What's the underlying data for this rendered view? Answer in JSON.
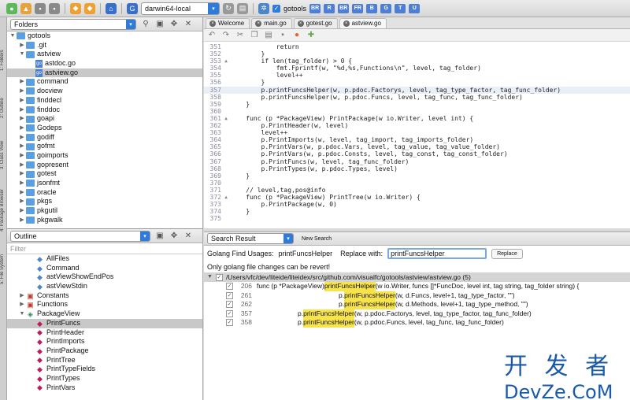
{
  "toolbar": {
    "env": "darwin64-local",
    "project_check_label": "gotools",
    "chips": [
      "BR",
      "R",
      "BR",
      "FR",
      "B",
      "G",
      "T",
      "U"
    ]
  },
  "side_tabs": [
    "1: Folders",
    "2: Outline",
    "3: Class View",
    "4: Package Browser",
    "5: File System"
  ],
  "folders_panel": {
    "title": "Folders",
    "items": [
      {
        "depth": 0,
        "expand": "▼",
        "kind": "folder",
        "label": "gotools",
        "sel": false
      },
      {
        "depth": 1,
        "expand": "▶",
        "kind": "folder",
        "label": ".git",
        "sel": false
      },
      {
        "depth": 1,
        "expand": "▼",
        "kind": "folder",
        "label": "astview",
        "sel": false
      },
      {
        "depth": 2,
        "expand": "",
        "kind": "file",
        "label": "astdoc.go",
        "sel": false
      },
      {
        "depth": 2,
        "expand": "",
        "kind": "file",
        "label": "astview.go",
        "sel": true
      },
      {
        "depth": 1,
        "expand": "▶",
        "kind": "folder",
        "label": "command",
        "sel": false
      },
      {
        "depth": 1,
        "expand": "▶",
        "kind": "folder",
        "label": "docview",
        "sel": false
      },
      {
        "depth": 1,
        "expand": "▶",
        "kind": "folder",
        "label": "finddecl",
        "sel": false
      },
      {
        "depth": 1,
        "expand": "▶",
        "kind": "folder",
        "label": "finddoc",
        "sel": false
      },
      {
        "depth": 1,
        "expand": "▶",
        "kind": "folder",
        "label": "goapi",
        "sel": false
      },
      {
        "depth": 1,
        "expand": "▶",
        "kind": "folder",
        "label": "Godeps",
        "sel": false
      },
      {
        "depth": 1,
        "expand": "▶",
        "kind": "folder",
        "label": "godiff",
        "sel": false
      },
      {
        "depth": 1,
        "expand": "▶",
        "kind": "folder",
        "label": "gofmt",
        "sel": false
      },
      {
        "depth": 1,
        "expand": "▶",
        "kind": "folder",
        "label": "goimports",
        "sel": false
      },
      {
        "depth": 1,
        "expand": "▶",
        "kind": "folder",
        "label": "gopresent",
        "sel": false
      },
      {
        "depth": 1,
        "expand": "▶",
        "kind": "folder",
        "label": "gotest",
        "sel": false
      },
      {
        "depth": 1,
        "expand": "▶",
        "kind": "folder",
        "label": "jsonfmt",
        "sel": false
      },
      {
        "depth": 1,
        "expand": "▶",
        "kind": "folder",
        "label": "oracle",
        "sel": false
      },
      {
        "depth": 1,
        "expand": "▶",
        "kind": "folder",
        "label": "pkgs",
        "sel": false
      },
      {
        "depth": 1,
        "expand": "▶",
        "kind": "folder",
        "label": "pkgutil",
        "sel": false
      },
      {
        "depth": 1,
        "expand": "▶",
        "kind": "folder",
        "label": "pkgwalk",
        "sel": false
      }
    ]
  },
  "outline_panel": {
    "title": "Outline",
    "filter_placeholder": "Filter",
    "items": [
      {
        "depth": 2,
        "expand": "",
        "icon": "◆",
        "color": "#4a86c8",
        "label": "AllFiles",
        "sel": false
      },
      {
        "depth": 2,
        "expand": "",
        "icon": "◆",
        "color": "#4a86c8",
        "label": "Command",
        "sel": false
      },
      {
        "depth": 2,
        "expand": "",
        "icon": "◆",
        "color": "#4a86c8",
        "label": "astViewShowEndPos",
        "sel": false
      },
      {
        "depth": 2,
        "expand": "",
        "icon": "◆",
        "color": "#4a86c8",
        "label": "astViewStdin",
        "sel": false
      },
      {
        "depth": 1,
        "expand": "▶",
        "icon": "▣",
        "color": "#c0392b",
        "label": "Constants",
        "sel": false
      },
      {
        "depth": 1,
        "expand": "▶",
        "icon": "▣",
        "color": "#c0392b",
        "label": "Functions",
        "sel": false
      },
      {
        "depth": 1,
        "expand": "▼",
        "icon": "◈",
        "color": "#2e8b57",
        "label": "PackageView",
        "sel": false
      },
      {
        "depth": 2,
        "expand": "",
        "icon": "◆",
        "color": "#c2185b",
        "label": "PrintFuncs",
        "sel": true
      },
      {
        "depth": 2,
        "expand": "",
        "icon": "◆",
        "color": "#c2185b",
        "label": "PrintHeader",
        "sel": false
      },
      {
        "depth": 2,
        "expand": "",
        "icon": "◆",
        "color": "#c2185b",
        "label": "PrintImports",
        "sel": false
      },
      {
        "depth": 2,
        "expand": "",
        "icon": "◆",
        "color": "#c2185b",
        "label": "PrintPackage",
        "sel": false
      },
      {
        "depth": 2,
        "expand": "",
        "icon": "◆",
        "color": "#c2185b",
        "label": "PrintTree",
        "sel": false
      },
      {
        "depth": 2,
        "expand": "",
        "icon": "◆",
        "color": "#c2185b",
        "label": "PrintTypeFields",
        "sel": false
      },
      {
        "depth": 2,
        "expand": "",
        "icon": "◆",
        "color": "#c2185b",
        "label": "PrintTypes",
        "sel": false
      },
      {
        "depth": 2,
        "expand": "",
        "icon": "◆",
        "color": "#c2185b",
        "label": "PrintVars",
        "sel": false
      }
    ]
  },
  "editor": {
    "tabs": [
      {
        "label": "Welcome",
        "active": false
      },
      {
        "label": "main.go",
        "active": false
      },
      {
        "label": "gotest.go",
        "active": false
      },
      {
        "label": "astview.go",
        "active": true
      }
    ],
    "lines": [
      {
        "n": "351",
        "fold": "",
        "text": "            return",
        "cur": false
      },
      {
        "n": "352",
        "fold": "",
        "text": "        }",
        "cur": false
      },
      {
        "n": "353",
        "fold": "▲",
        "text": "        if len(tag_folder) > 0 {",
        "cur": false
      },
      {
        "n": "354",
        "fold": "",
        "text": "            fmt.Fprintf(w, \"%d,%s,Functions\\n\", level, tag_folder)",
        "cur": false
      },
      {
        "n": "355",
        "fold": "",
        "text": "            level++",
        "cur": false
      },
      {
        "n": "356",
        "fold": "",
        "text": "        }",
        "cur": false
      },
      {
        "n": "357",
        "fold": "",
        "text": "        p.printFuncsHelper(w, p.pdoc.Factorys, level, tag_type_factor, tag_func_folder)",
        "cur": true
      },
      {
        "n": "358",
        "fold": "",
        "text": "        p.printFuncsHelper(w, p.pdoc.Funcs, level, tag_func, tag_func_folder)",
        "cur": false
      },
      {
        "n": "359",
        "fold": "",
        "text": "    }",
        "cur": false
      },
      {
        "n": "360",
        "fold": "",
        "text": "",
        "cur": false
      },
      {
        "n": "361",
        "fold": "▲",
        "text": "    func (p *PackageView) PrintPackage(w io.Writer, level int) {",
        "cur": false
      },
      {
        "n": "362",
        "fold": "",
        "text": "        p.PrintHeader(w, level)",
        "cur": false
      },
      {
        "n": "363",
        "fold": "",
        "text": "        level++",
        "cur": false
      },
      {
        "n": "364",
        "fold": "",
        "text": "        p.PrintImports(w, level, tag_import, tag_imports_folder)",
        "cur": false
      },
      {
        "n": "365",
        "fold": "",
        "text": "        p.PrintVars(w, p.pdoc.Vars, level, tag_value, tag_value_folder)",
        "cur": false
      },
      {
        "n": "366",
        "fold": "",
        "text": "        p.PrintVars(w, p.pdoc.Consts, level, tag_const, tag_const_folder)",
        "cur": false
      },
      {
        "n": "367",
        "fold": "",
        "text": "        p.PrintFuncs(w, level, tag_func_folder)",
        "cur": false
      },
      {
        "n": "368",
        "fold": "",
        "text": "        p.PrintTypes(w, p.pdoc.Types, level)",
        "cur": false
      },
      {
        "n": "369",
        "fold": "",
        "text": "    }",
        "cur": false
      },
      {
        "n": "370",
        "fold": "",
        "text": "",
        "cur": false
      },
      {
        "n": "371",
        "fold": "",
        "text": "    // level,tag,pos@info",
        "cur": false
      },
      {
        "n": "372",
        "fold": "▲",
        "text": "    func (p *PackageView) PrintTree(w io.Writer) {",
        "cur": false
      },
      {
        "n": "373",
        "fold": "",
        "text": "        p.PrintPackage(w, 0)",
        "cur": false
      },
      {
        "n": "374",
        "fold": "",
        "text": "    }",
        "cur": false
      },
      {
        "n": "375",
        "fold": "",
        "text": "",
        "cur": false
      }
    ]
  },
  "search": {
    "title": "Search Result",
    "new_search": "New Search",
    "usage_label": "Golang Find Usages:",
    "usage_term": "printFuncsHelper",
    "replace_label": "Replace with:",
    "replace_value": "printFuncsHelper",
    "replace_button": "Replace",
    "warning": "Only golang file changes can be revert!",
    "file_path": "/Users/vfc/dev/liteide/liteidex/src/github.com/visualfc/gotools/astview/astview.go (5)",
    "results": [
      {
        "n": "206",
        "pre": "func (p *PackageView) ",
        "match": "printFuncsHelper",
        "post": "(w io.Writer, funcs []*FuncDoc, level int, tag string, tag_folder string) {",
        "indent": 0
      },
      {
        "n": "261",
        "pre": "p.",
        "match": "printFuncsHelper",
        "post": "(w, d.Funcs, level+1, tag_type_factor, \"\")",
        "indent": 104
      },
      {
        "n": "262",
        "pre": "p.",
        "match": "printFuncsHelper",
        "post": "(w, d.Methods, level+1, tag_type_method, \"\")",
        "indent": 104
      },
      {
        "n": "357",
        "pre": "p.",
        "match": "printFuncsHelper",
        "post": "(w, p.pdoc.Factorys, level, tag_type_factor, tag_func_folder)",
        "indent": 52
      },
      {
        "n": "358",
        "pre": "p.",
        "match": "printFuncsHelper",
        "post": "(w, p.pdoc.Funcs, level, tag_func, tag_func_folder)",
        "indent": 52
      }
    ]
  },
  "watermark": {
    "cn": "开 发 者",
    "en": "DevZe.CoM"
  }
}
